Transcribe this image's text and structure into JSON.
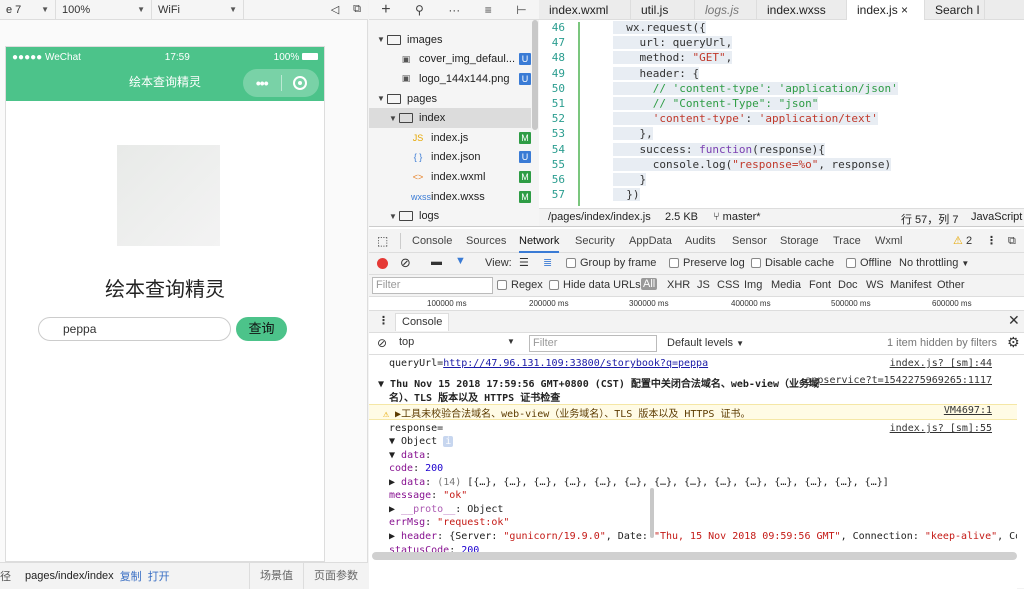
{
  "sim_toolbar": {
    "device": "e 7",
    "zoom": "100%",
    "network": "WiFi"
  },
  "phone": {
    "carrier": "●●●●● WeChat",
    "time": "17:59",
    "battery": "100%",
    "nav_title": "绘本查询精灵",
    "app_title": "绘本查询精灵",
    "search_value": "peppa",
    "search_button": "查询"
  },
  "sim_bottom": {
    "path_label": "径",
    "page_path": "pages/index/index",
    "copy": "复制",
    "open": "打开",
    "scene": "场景值",
    "params": "页面参数"
  },
  "file_tree": [
    {
      "name": "images",
      "type": "folder",
      "open": true,
      "depth": 0
    },
    {
      "name": "cover_img_defaul...",
      "type": "image",
      "depth": 1,
      "badge": "U"
    },
    {
      "name": "logo_144x144.png",
      "type": "image",
      "depth": 1,
      "badge": "U"
    },
    {
      "name": "pages",
      "type": "folder",
      "open": true,
      "depth": 0
    },
    {
      "name": "index",
      "type": "folder",
      "open": true,
      "depth": 1,
      "selected": true
    },
    {
      "name": "index.js",
      "type": "js",
      "depth": 2,
      "badge": "M"
    },
    {
      "name": "index.json",
      "type": "json",
      "depth": 2,
      "badge": "U"
    },
    {
      "name": "index.wxml",
      "type": "wxml",
      "depth": 2,
      "badge": "M"
    },
    {
      "name": "index.wxss",
      "type": "wxss",
      "depth": 2,
      "badge": "M"
    },
    {
      "name": "logs",
      "type": "folder",
      "open": true,
      "depth": 1
    }
  ],
  "editor_tabs": [
    {
      "label": "index.wxml",
      "style": "normal",
      "width": 92
    },
    {
      "label": "util.js",
      "style": "normal",
      "width": 64
    },
    {
      "label": "logs.js",
      "style": "italic",
      "width": 62
    },
    {
      "label": "index.wxss",
      "style": "normal",
      "width": 90
    },
    {
      "label": "index.js",
      "style": "active",
      "width": 78,
      "close": "×"
    },
    {
      "label": "Search I",
      "style": "normal",
      "width": 60
    }
  ],
  "code_lines": [
    {
      "n": "46",
      "html": "  wx.request({"
    },
    {
      "n": "47",
      "html": "    url: queryUrl,"
    },
    {
      "n": "48",
      "html": "    method: <span class=\"str\">\"GET\"</span>,"
    },
    {
      "n": "49",
      "html": "    header: {"
    },
    {
      "n": "50",
      "html": "      <span class=\"cmt\">// 'content-type': 'application/json'</span>"
    },
    {
      "n": "51",
      "html": "      <span class=\"cmt\">// \"Content-Type\": \"json\"</span>"
    },
    {
      "n": "52",
      "html": "      <span class=\"str\">'content-type'</span>: <span class=\"str\">'application/text'</span>"
    },
    {
      "n": "53",
      "html": "    },"
    },
    {
      "n": "54",
      "html": "    success: <span class=\"kw\">function</span>(response){"
    },
    {
      "n": "55",
      "html": "      console.log(<span class=\"str\">\"response=%o\"</span>, response)"
    },
    {
      "n": "56",
      "html": "    }"
    },
    {
      "n": "57",
      "html": "  })"
    }
  ],
  "editor_status": {
    "path": "/pages/index/index.js",
    "size": "2.5 KB",
    "branch": "master*",
    "position": "行 57，列 7",
    "language": "JavaScript"
  },
  "devtools_tabs": [
    "Console",
    "Sources",
    "Network",
    "Security",
    "AppData",
    "Audits",
    "Sensor",
    "Storage",
    "Trace",
    "Wxml"
  ],
  "devtools_active_tab": "Network",
  "warn_count": "2",
  "network": {
    "view_label": "View:",
    "group_by_frame": "Group by frame",
    "preserve_log": "Preserve log",
    "disable_cache": "Disable cache",
    "offline": "Offline",
    "throttle": "No throttling",
    "filter_placeholder": "Filter",
    "regex": "Regex",
    "hide_data_urls": "Hide data URLs",
    "types": [
      "All",
      "XHR",
      "JS",
      "CSS",
      "Img",
      "Media",
      "Font",
      "Doc",
      "WS",
      "Manifest",
      "Other"
    ],
    "timeline_ticks": [
      "100000 ms",
      "200000 ms",
      "300000 ms",
      "400000 ms",
      "500000 ms",
      "600000 ms"
    ]
  },
  "console_drawer": {
    "title": "Console",
    "context": "top",
    "filter_placeholder": "Filter",
    "levels": "Default levels",
    "hidden_info": "1 item hidden by filters"
  },
  "console_lines": [
    {
      "text": "queryUrl=<span class=\"link\">http://47.96.131.109:33800/storybook?q=peppa</span>",
      "src": "index.js? [sm]:44"
    },
    {
      "text": "<b>Thu Nov 15 2018 17:59:56 GMT+0800 (CST) 配置中关闭合法域名、web-view（业务域</b>",
      "src": "appservice?t=1542275969265:1117",
      "tri": "▼"
    },
    {
      "text": "<b>名）、TLS 版本以及 HTTPS 证书检查</b>",
      "src": ""
    },
    {
      "text": "▶工具未校验合法域名、web-view（业务域名）、TLS 版本以及 HTTPS 证书。",
      "src": "VM4697:1",
      "warn": true
    },
    {
      "text": "response=",
      "src": "index.js? [sm]:55"
    },
    {
      "text": "▼ Object <span style=\"background:#c7d6ef;color:#fff;padding:0 2px;border-radius:2px;\">i</span>",
      "src": ""
    },
    {
      "text": "    ▼ <span class=\"purple\">data</span>:",
      "src": ""
    },
    {
      "text": "        <span class=\"purple\">code</span>: <span class=\"blue\">200</span>",
      "src": ""
    },
    {
      "text": "      ▶ <span class=\"purple\">data</span>: <span class=\"grey\">(14)</span> [{…}, {…}, {…}, {…}, {…}, {…}, {…}, {…}, {…}, {…}, {…}, {…}, {…}, {…}]",
      "src": ""
    },
    {
      "text": "        <span class=\"purple\">message</span>: <span class=\"red\">\"ok\"</span>",
      "src": ""
    },
    {
      "text": "      ▶ <span class=\"purple\" style=\"opacity:0.7\">__proto__</span>: Object",
      "src": ""
    },
    {
      "text": "      <span class=\"purple\">errMsg</span>: <span class=\"red\">\"request:ok\"</span>",
      "src": ""
    },
    {
      "text": "    ▶ <span class=\"purple\">header</span>: {Server: <span class=\"red\">\"gunicorn/19.9.0\"</span>, Date: <span class=\"red\">\"Thu, 15 Nov 2018 09:59:56 GMT\"</span>, Connection: <span class=\"red\">\"keep-alive\"</span>, Content",
      "src": ""
    },
    {
      "text": "      <span class=\"purple\">statusCode</span>: <span class=\"blue\">200</span>",
      "src": ""
    }
  ]
}
